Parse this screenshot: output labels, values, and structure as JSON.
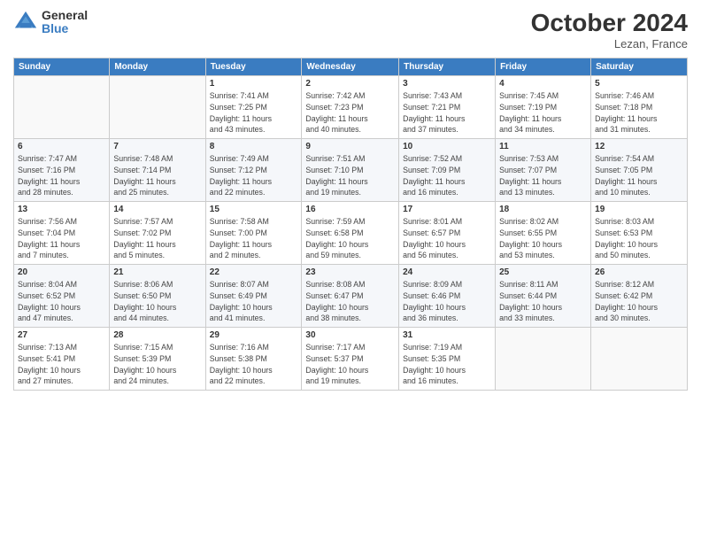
{
  "header": {
    "logo_general": "General",
    "logo_blue": "Blue",
    "month_title": "October 2024",
    "location": "Lezan, France"
  },
  "weekdays": [
    "Sunday",
    "Monday",
    "Tuesday",
    "Wednesday",
    "Thursday",
    "Friday",
    "Saturday"
  ],
  "weeks": [
    [
      {
        "day": "",
        "info": ""
      },
      {
        "day": "",
        "info": ""
      },
      {
        "day": "1",
        "info": "Sunrise: 7:41 AM\nSunset: 7:25 PM\nDaylight: 11 hours\nand 43 minutes."
      },
      {
        "day": "2",
        "info": "Sunrise: 7:42 AM\nSunset: 7:23 PM\nDaylight: 11 hours\nand 40 minutes."
      },
      {
        "day": "3",
        "info": "Sunrise: 7:43 AM\nSunset: 7:21 PM\nDaylight: 11 hours\nand 37 minutes."
      },
      {
        "day": "4",
        "info": "Sunrise: 7:45 AM\nSunset: 7:19 PM\nDaylight: 11 hours\nand 34 minutes."
      },
      {
        "day": "5",
        "info": "Sunrise: 7:46 AM\nSunset: 7:18 PM\nDaylight: 11 hours\nand 31 minutes."
      }
    ],
    [
      {
        "day": "6",
        "info": "Sunrise: 7:47 AM\nSunset: 7:16 PM\nDaylight: 11 hours\nand 28 minutes."
      },
      {
        "day": "7",
        "info": "Sunrise: 7:48 AM\nSunset: 7:14 PM\nDaylight: 11 hours\nand 25 minutes."
      },
      {
        "day": "8",
        "info": "Sunrise: 7:49 AM\nSunset: 7:12 PM\nDaylight: 11 hours\nand 22 minutes."
      },
      {
        "day": "9",
        "info": "Sunrise: 7:51 AM\nSunset: 7:10 PM\nDaylight: 11 hours\nand 19 minutes."
      },
      {
        "day": "10",
        "info": "Sunrise: 7:52 AM\nSunset: 7:09 PM\nDaylight: 11 hours\nand 16 minutes."
      },
      {
        "day": "11",
        "info": "Sunrise: 7:53 AM\nSunset: 7:07 PM\nDaylight: 11 hours\nand 13 minutes."
      },
      {
        "day": "12",
        "info": "Sunrise: 7:54 AM\nSunset: 7:05 PM\nDaylight: 11 hours\nand 10 minutes."
      }
    ],
    [
      {
        "day": "13",
        "info": "Sunrise: 7:56 AM\nSunset: 7:04 PM\nDaylight: 11 hours\nand 7 minutes."
      },
      {
        "day": "14",
        "info": "Sunrise: 7:57 AM\nSunset: 7:02 PM\nDaylight: 11 hours\nand 5 minutes."
      },
      {
        "day": "15",
        "info": "Sunrise: 7:58 AM\nSunset: 7:00 PM\nDaylight: 11 hours\nand 2 minutes."
      },
      {
        "day": "16",
        "info": "Sunrise: 7:59 AM\nSunset: 6:58 PM\nDaylight: 10 hours\nand 59 minutes."
      },
      {
        "day": "17",
        "info": "Sunrise: 8:01 AM\nSunset: 6:57 PM\nDaylight: 10 hours\nand 56 minutes."
      },
      {
        "day": "18",
        "info": "Sunrise: 8:02 AM\nSunset: 6:55 PM\nDaylight: 10 hours\nand 53 minutes."
      },
      {
        "day": "19",
        "info": "Sunrise: 8:03 AM\nSunset: 6:53 PM\nDaylight: 10 hours\nand 50 minutes."
      }
    ],
    [
      {
        "day": "20",
        "info": "Sunrise: 8:04 AM\nSunset: 6:52 PM\nDaylight: 10 hours\nand 47 minutes."
      },
      {
        "day": "21",
        "info": "Sunrise: 8:06 AM\nSunset: 6:50 PM\nDaylight: 10 hours\nand 44 minutes."
      },
      {
        "day": "22",
        "info": "Sunrise: 8:07 AM\nSunset: 6:49 PM\nDaylight: 10 hours\nand 41 minutes."
      },
      {
        "day": "23",
        "info": "Sunrise: 8:08 AM\nSunset: 6:47 PM\nDaylight: 10 hours\nand 38 minutes."
      },
      {
        "day": "24",
        "info": "Sunrise: 8:09 AM\nSunset: 6:46 PM\nDaylight: 10 hours\nand 36 minutes."
      },
      {
        "day": "25",
        "info": "Sunrise: 8:11 AM\nSunset: 6:44 PM\nDaylight: 10 hours\nand 33 minutes."
      },
      {
        "day": "26",
        "info": "Sunrise: 8:12 AM\nSunset: 6:42 PM\nDaylight: 10 hours\nand 30 minutes."
      }
    ],
    [
      {
        "day": "27",
        "info": "Sunrise: 7:13 AM\nSunset: 5:41 PM\nDaylight: 10 hours\nand 27 minutes."
      },
      {
        "day": "28",
        "info": "Sunrise: 7:15 AM\nSunset: 5:39 PM\nDaylight: 10 hours\nand 24 minutes."
      },
      {
        "day": "29",
        "info": "Sunrise: 7:16 AM\nSunset: 5:38 PM\nDaylight: 10 hours\nand 22 minutes."
      },
      {
        "day": "30",
        "info": "Sunrise: 7:17 AM\nSunset: 5:37 PM\nDaylight: 10 hours\nand 19 minutes."
      },
      {
        "day": "31",
        "info": "Sunrise: 7:19 AM\nSunset: 5:35 PM\nDaylight: 10 hours\nand 16 minutes."
      },
      {
        "day": "",
        "info": ""
      },
      {
        "day": "",
        "info": ""
      }
    ]
  ]
}
